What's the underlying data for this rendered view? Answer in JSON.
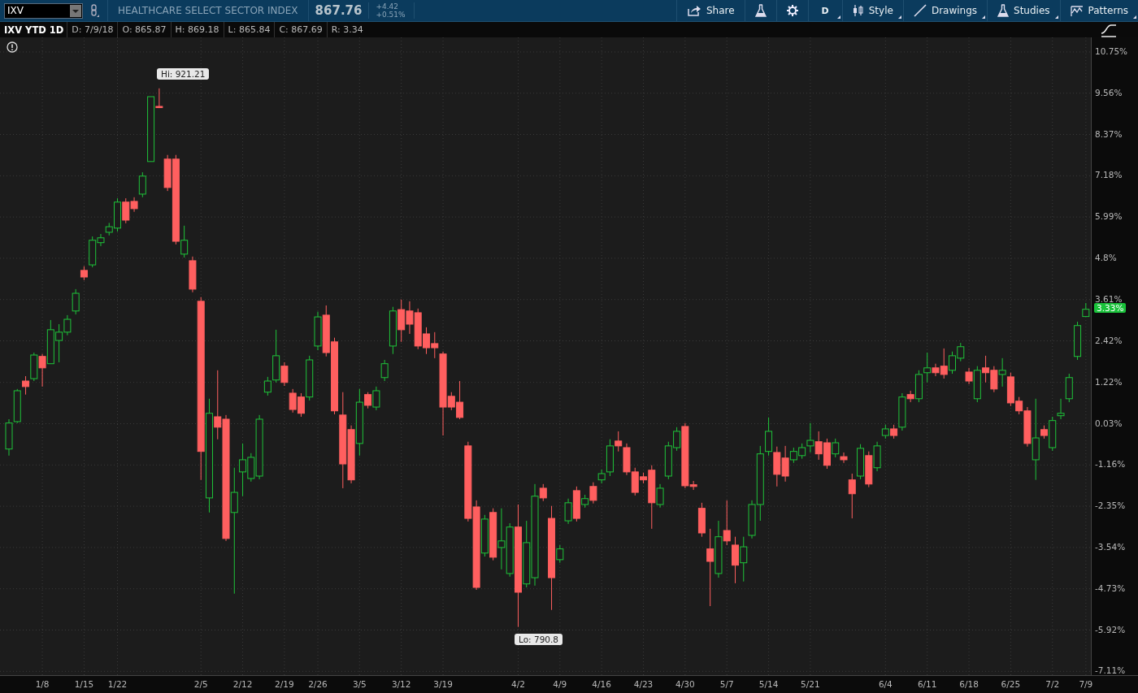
{
  "symbol_field": {
    "value": "IXV"
  },
  "symbol_name": "HEALTHCARE SELECT SECTOR INDEX",
  "last_price": "867.76",
  "change": "+4.42",
  "change_percent": "+0.51%",
  "toolbar": [
    {
      "kind": "share",
      "label": "Share",
      "menu": false
    },
    {
      "kind": "flask",
      "menu": false
    },
    {
      "kind": "gear",
      "menu": false
    },
    {
      "kind": "aggregation",
      "label": "D",
      "menu": true
    },
    {
      "kind": "style",
      "label": "Style",
      "menu": true
    },
    {
      "kind": "drawings",
      "label": "Drawings",
      "menu": true
    },
    {
      "kind": "studies",
      "label": "Studies",
      "menu": true
    },
    {
      "kind": "patterns",
      "label": "Patterns",
      "menu": true
    }
  ],
  "chart_title": "IXV YTD 1D",
  "quote_fields": [
    "D: 7/9/18",
    "O: 865.87",
    "H: 869.18",
    "L: 865.84",
    "C: 867.69",
    "R: 3.34"
  ],
  "current_badge": "3.33%",
  "high_label": "Hi: 921.21",
  "low_label": "Lo: 790.8",
  "chart": {
    "chart_data": {
      "type": "candlestick",
      "categories": [
        null,
        null,
        null,
        null,
        "1/8",
        null,
        null,
        null,
        null,
        "1/15",
        null,
        null,
        null,
        "1/22",
        null,
        null,
        null,
        null,
        null,
        null,
        null,
        null,
        null,
        "2/5",
        null,
        null,
        null,
        null,
        "2/12",
        null,
        null,
        null,
        null,
        "2/19",
        null,
        null,
        null,
        "2/26",
        null,
        null,
        null,
        null,
        "3/5",
        null,
        null,
        null,
        null,
        "3/12",
        null,
        null,
        null,
        null,
        "3/19",
        null,
        null,
        null,
        null,
        null,
        null,
        null,
        null,
        "4/2",
        null,
        null,
        null,
        null,
        "4/9",
        null,
        null,
        null,
        null,
        "4/16",
        null,
        null,
        null,
        null,
        "4/23",
        null,
        null,
        null,
        null,
        "4/30",
        null,
        null,
        null,
        null,
        "5/7",
        null,
        null,
        null,
        null,
        "5/14",
        null,
        null,
        null,
        null,
        "5/21",
        null,
        null,
        null,
        null,
        null,
        null,
        null,
        null,
        "6/4",
        null,
        null,
        null,
        null,
        "6/11",
        null,
        null,
        null,
        null,
        "6/18",
        null,
        null,
        null,
        null,
        "6/25",
        null,
        null,
        null,
        null,
        "7/2",
        null,
        null,
        null,
        "7/9"
      ],
      "grid": true,
      "ohlc": [
        [
          -0.7,
          0.16,
          -0.89,
          0.05
        ],
        [
          0.09,
          1.03,
          0.05,
          0.98
        ],
        [
          1.26,
          1.4,
          0.87,
          1.1
        ],
        [
          1.33,
          2.08,
          1.26,
          2.01
        ],
        [
          1.97,
          2.04,
          1.1,
          1.64
        ],
        [
          1.76,
          3.02,
          1.76,
          2.74
        ],
        [
          2.43,
          2.9,
          1.8,
          2.67
        ],
        [
          2.67,
          3.16,
          2.58,
          3.04
        ],
        [
          3.28,
          3.91,
          3.18,
          3.79
        ],
        [
          4.45,
          4.57,
          4.17,
          4.26
        ],
        [
          4.61,
          5.43,
          4.54,
          5.32
        ],
        [
          5.25,
          5.5,
          5.15,
          5.39
        ],
        [
          5.55,
          5.82,
          5.46,
          5.71
        ],
        [
          5.67,
          6.53,
          5.57,
          6.42
        ],
        [
          6.42,
          6.53,
          5.81,
          5.9
        ],
        [
          6.44,
          6.56,
          6.14,
          6.23
        ],
        [
          6.65,
          7.28,
          6.56,
          7.17
        ],
        [
          7.59,
          9.46,
          7.59,
          9.46
        ],
        [
          9.18,
          9.7,
          9.13,
          9.16
        ],
        [
          7.66,
          7.78,
          6.74,
          6.84
        ],
        [
          7.66,
          7.78,
          5.2,
          5.29
        ],
        [
          4.92,
          5.74,
          4.82,
          5.32
        ],
        [
          4.73,
          4.85,
          3.82,
          3.91
        ],
        [
          3.56,
          3.68,
          -1.59,
          -0.77
        ],
        [
          -2.11,
          0.75,
          -2.53,
          0.33
        ],
        [
          0.23,
          1.57,
          -0.42,
          -0.07
        ],
        [
          0.16,
          0.28,
          -3.35,
          -3.28
        ],
        [
          -2.53,
          -1.24,
          -4.87,
          -1.95
        ],
        [
          -1.36,
          -0.54,
          -2.06,
          -1.01
        ],
        [
          -1.55,
          -0.82,
          -1.64,
          -0.94
        ],
        [
          -1.48,
          0.28,
          -1.57,
          0.16
        ],
        [
          0.94,
          1.38,
          0.84,
          1.26
        ],
        [
          1.29,
          2.74,
          1.22,
          1.99
        ],
        [
          1.69,
          1.8,
          1.12,
          1.22
        ],
        [
          0.91,
          1.03,
          0.35,
          0.44
        ],
        [
          0.8,
          0.91,
          0.23,
          0.33
        ],
        [
          0.8,
          1.99,
          0.7,
          1.87
        ],
        [
          2.27,
          3.26,
          2.15,
          3.11
        ],
        [
          3.16,
          3.44,
          1.97,
          2.08
        ],
        [
          2.39,
          2.51,
          0.3,
          0.4
        ],
        [
          0.28,
          0.94,
          -1.83,
          -1.13
        ],
        [
          -0.14,
          -0.02,
          -1.69,
          -1.59
        ],
        [
          -0.54,
          1.03,
          -0.89,
          0.65
        ],
        [
          0.87,
          0.94,
          0.47,
          0.56
        ],
        [
          0.51,
          1.1,
          0.42,
          0.98
        ],
        [
          1.36,
          1.87,
          1.26,
          1.76
        ],
        [
          2.27,
          3.4,
          2.04,
          3.28
        ],
        [
          3.32,
          3.61,
          2.39,
          2.74
        ],
        [
          3.28,
          3.56,
          2.62,
          2.9
        ],
        [
          3.23,
          3.35,
          2.18,
          2.27
        ],
        [
          2.62,
          2.81,
          2.04,
          2.22
        ],
        [
          2.34,
          2.67,
          1.92,
          2.22
        ],
        [
          2.04,
          2.11,
          -0.31,
          0.51
        ],
        [
          0.82,
          0.94,
          0.42,
          0.51
        ],
        [
          0.65,
          1.26,
          0.16,
          0.21
        ],
        [
          -0.61,
          -0.49,
          -2.79,
          -2.7
        ],
        [
          -2.37,
          -2.18,
          -4.76,
          -4.69
        ],
        [
          -3.7,
          -2.6,
          -3.8,
          -2.72
        ],
        [
          -2.53,
          -2.41,
          -3.91,
          -3.82
        ],
        [
          -3.54,
          -2.41,
          -4.17,
          -3.35
        ],
        [
          -4.29,
          -2.84,
          -4.38,
          -2.95
        ],
        [
          -2.95,
          -2.3,
          -5.83,
          -4.83
        ],
        [
          -4.59,
          -2.77,
          -4.69,
          -3.4
        ],
        [
          -4.41,
          -1.71,
          -4.64,
          -2.06
        ],
        [
          -1.83,
          -1.71,
          -2.2,
          -2.11
        ],
        [
          -2.7,
          -2.34,
          -5.34,
          -4.41
        ],
        [
          -3.89,
          -3.47,
          -3.98,
          -3.58
        ],
        [
          -2.77,
          -2.13,
          -2.86,
          -2.25
        ],
        [
          -1.9,
          -1.78,
          -2.79,
          -2.7
        ],
        [
          -2.3,
          -2.02,
          -2.39,
          -2.13
        ],
        [
          -1.78,
          -1.66,
          -2.27,
          -2.18
        ],
        [
          -1.59,
          -1.29,
          -1.69,
          -1.41
        ],
        [
          -1.36,
          -0.42,
          -1.48,
          -0.61
        ],
        [
          -0.47,
          -0.19,
          -0.77,
          -0.61
        ],
        [
          -0.66,
          -0.54,
          -1.45,
          -1.36
        ],
        [
          -1.36,
          -1.24,
          -2.04,
          -1.95
        ],
        [
          -1.5,
          -1.38,
          -1.69,
          -1.59
        ],
        [
          -1.31,
          -1.17,
          -3.0,
          -2.25
        ],
        [
          -2.3,
          -1.71,
          -2.39,
          -1.83
        ],
        [
          -1.48,
          -0.49,
          -1.57,
          -0.61
        ],
        [
          -0.66,
          -0.07,
          -0.75,
          -0.19
        ],
        [
          -0.05,
          0.05,
          -1.83,
          -1.76
        ],
        [
          -1.73,
          -1.62,
          -1.88,
          -1.78
        ],
        [
          -2.41,
          -2.25,
          -3.23,
          -3.12
        ],
        [
          -3.58,
          -3.0,
          -5.23,
          -3.94
        ],
        [
          -4.29,
          -2.77,
          -4.41,
          -3.23
        ],
        [
          -3.05,
          -2.18,
          -3.47,
          -3.35
        ],
        [
          -3.47,
          -3.23,
          -4.57,
          -4.05
        ],
        [
          -3.98,
          -3.23,
          -4.52,
          -3.52
        ],
        [
          -3.19,
          -2.18,
          -3.28,
          -2.3
        ],
        [
          -2.3,
          -0.61,
          -2.77,
          -0.84
        ],
        [
          -0.77,
          0.21,
          -0.89,
          -0.19
        ],
        [
          -0.8,
          -0.63,
          -1.78,
          -1.43
        ],
        [
          -0.96,
          -0.61,
          -1.64,
          -1.48
        ],
        [
          -1.01,
          -0.66,
          -1.1,
          -0.77
        ],
        [
          -0.89,
          -0.54,
          -0.98,
          -0.66
        ],
        [
          -0.61,
          0.05,
          -0.8,
          -0.45
        ],
        [
          -0.49,
          -0.19,
          -1.01,
          -0.84
        ],
        [
          -0.52,
          -0.4,
          -1.27,
          -1.17
        ],
        [
          -0.84,
          -0.4,
          -0.94,
          -0.52
        ],
        [
          -0.92,
          -0.8,
          -1.1,
          -1.01
        ],
        [
          -1.59,
          -1.41,
          -2.7,
          -1.99
        ],
        [
          -1.48,
          -0.56,
          -1.57,
          -0.68
        ],
        [
          -0.89,
          -0.77,
          -1.8,
          -1.71
        ],
        [
          -1.24,
          -0.49,
          -1.34,
          -0.61
        ],
        [
          -0.31,
          0.0,
          -0.4,
          -0.12
        ],
        [
          -0.12,
          0.0,
          -0.4,
          -0.31
        ],
        [
          -0.07,
          0.91,
          -0.17,
          0.8
        ],
        [
          0.87,
          0.98,
          0.65,
          0.75
        ],
        [
          0.75,
          1.57,
          0.65,
          1.45
        ],
        [
          1.5,
          2.08,
          1.22,
          1.64
        ],
        [
          1.64,
          1.76,
          1.4,
          1.5
        ],
        [
          1.69,
          2.2,
          1.33,
          1.45
        ],
        [
          1.57,
          2.11,
          1.47,
          1.99
        ],
        [
          1.92,
          2.36,
          1.83,
          2.25
        ],
        [
          1.52,
          1.64,
          1.17,
          1.26
        ],
        [
          0.75,
          1.69,
          0.65,
          1.57
        ],
        [
          1.64,
          1.99,
          1.22,
          1.5
        ],
        [
          1.57,
          1.69,
          0.94,
          1.03
        ],
        [
          1.45,
          1.92,
          1.1,
          1.57
        ],
        [
          1.38,
          1.5,
          0.54,
          0.63
        ],
        [
          0.68,
          0.8,
          0.3,
          0.4
        ],
        [
          0.4,
          0.51,
          -0.63,
          -0.54
        ],
        [
          -1.01,
          0.75,
          -1.59,
          -0.38
        ],
        [
          -0.14,
          -0.02,
          -0.4,
          -0.31
        ],
        [
          -0.66,
          0.23,
          -0.75,
          0.12
        ],
        [
          0.26,
          0.75,
          0.16,
          0.33
        ],
        [
          0.75,
          1.47,
          0.65,
          1.36
        ],
        [
          1.97,
          2.97,
          1.87,
          2.86
        ],
        [
          3.12,
          3.51,
          3.11,
          3.33
        ]
      ],
      "ylim": [
        -7.22,
        11.17
      ],
      "yticks": [
        {
          "value": 10.75,
          "label": "10.75%"
        },
        {
          "value": 9.56,
          "label": "9.56%"
        },
        {
          "value": 8.37,
          "label": "8.37%"
        },
        {
          "value": 7.18,
          "label": "7.18%"
        },
        {
          "value": 5.99,
          "label": "5.99%"
        },
        {
          "value": 4.8,
          "label": "4.8%"
        },
        {
          "value": 3.61,
          "label": "3.61%"
        },
        {
          "value": 2.42,
          "label": "2.42%"
        },
        {
          "value": 1.22,
          "label": "1.22%"
        },
        {
          "value": 0.03,
          "label": "0.03%"
        },
        {
          "value": -1.16,
          "label": "-1.16%"
        },
        {
          "value": -2.35,
          "label": "-2.35%"
        },
        {
          "value": -3.54,
          "label": "-3.54%"
        },
        {
          "value": -4.73,
          "label": "-4.73%"
        },
        {
          "value": -5.92,
          "label": "-5.92%"
        },
        {
          "value": -7.11,
          "label": "-7.11%"
        }
      ]
    }
  }
}
